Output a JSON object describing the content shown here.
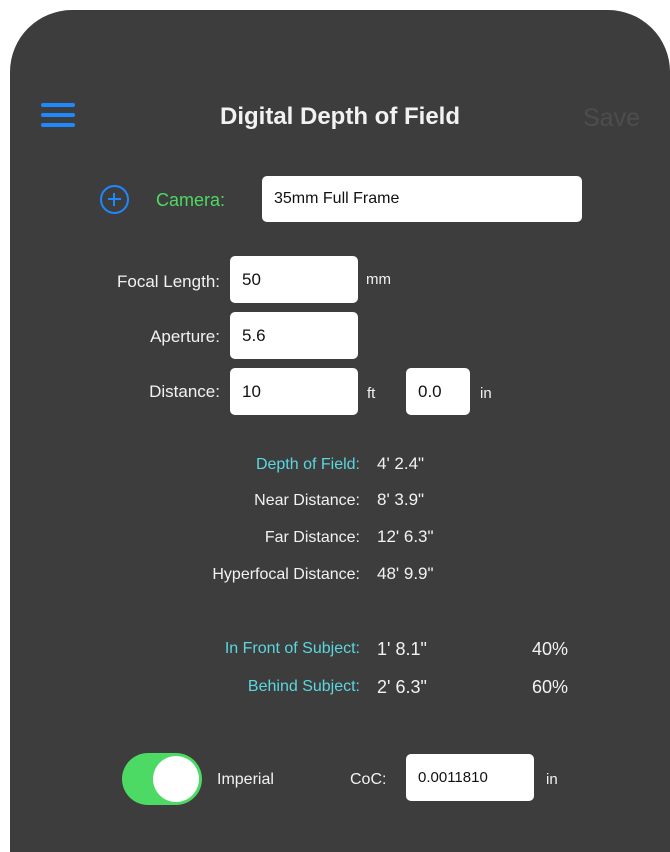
{
  "header": {
    "title": "Digital Depth of Field",
    "save_label": "Save"
  },
  "camera": {
    "label": "Camera:",
    "value": "35mm Full Frame"
  },
  "inputs": {
    "focal_length_label": "Focal Length:",
    "focal_length_value": "50",
    "focal_length_unit": "mm",
    "aperture_label": "Aperture:",
    "aperture_value": "5.6",
    "distance_label": "Distance:",
    "distance_ft_value": "10",
    "distance_ft_unit": "ft",
    "distance_in_value": "0.0",
    "distance_in_unit": "in"
  },
  "results": {
    "depth_of_field_label": "Depth of Field:",
    "depth_of_field_value": "4' 2.4\"",
    "near_distance_label": "Near Distance:",
    "near_distance_value": "8' 3.9\"",
    "far_distance_label": "Far Distance:",
    "far_distance_value": "12' 6.3\"",
    "hyperfocal_label": "Hyperfocal Distance:",
    "hyperfocal_value": "48' 9.9\""
  },
  "split": {
    "front_label": "In Front of Subject:",
    "front_value": "1' 8.1\"",
    "front_percent": "40%",
    "behind_label": "Behind Subject:",
    "behind_value": "2' 6.3\"",
    "behind_percent": "60%"
  },
  "footer": {
    "units_toggle_label": "Imperial",
    "units_toggle_on": true,
    "coc_label": "CoC:",
    "coc_value": "0.0011810",
    "coc_unit": "in"
  },
  "colors": {
    "background": "#3d3d3d",
    "accent_blue": "#1e88ff",
    "accent_green": "#4cd964",
    "accent_teal": "#5ad7e0"
  },
  "icons": {
    "menu": "hamburger-menu-icon",
    "add_camera": "plus-circle-icon"
  }
}
